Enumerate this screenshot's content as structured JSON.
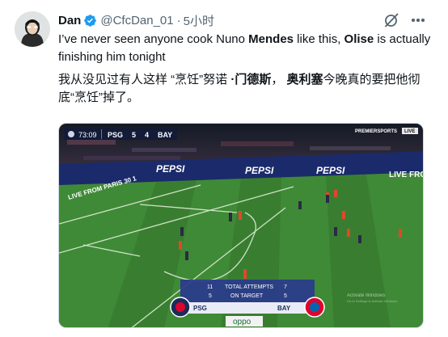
{
  "author": {
    "name": "Dan",
    "handle": "@CfcDan_01",
    "separator": "·",
    "time": "5小时"
  },
  "tweet": {
    "en_part1": "I’ve never seen anyone cook Nuno ",
    "en_bold1": "Mendes",
    "en_part2": " like this, ",
    "en_bold2": "Olise",
    "en_part3": " is actually  finishing him tonight",
    "zh_part1": "我从没见过有人这样 “烹饪”努诺 ",
    "zh_bold1": "·门德斯",
    "zh_part2": "， ",
    "zh_bold2": "奥利塞",
    "zh_part3": "今晚真的要把他彻底“烹饪”掉了。"
  },
  "media": {
    "scorebug": {
      "clock": "73:09",
      "home": "PSG",
      "home_score": "5",
      "away_score": "4",
      "away": "BAY"
    },
    "broadcaster": "PREMIERSPORTS",
    "broadcaster_live": "LIVE",
    "boards": [
      "PEPSI",
      "PEPSI",
      "PEPSI",
      "LIVE FRO"
    ],
    "board_left": "LIVE FROM PARIS 30 1",
    "stats": {
      "row1_home": "11",
      "row1_label": "TOTAL ATTEMPTS",
      "row1_away": "7",
      "row2_home": "5",
      "row2_label": "ON TARGET",
      "row2_away": "5",
      "home": "PSG",
      "away": "BAY"
    },
    "sponsor": "oppo",
    "watermark_1": "Activate Windows",
    "watermark_2": "Go to Settings to activate Windows."
  },
  "colors": {
    "verified": "#1d9bf0",
    "pitch": "#3f8a36",
    "psg": "#1b2b5c",
    "bayern": "#dc052d",
    "stats_bar": "#2a3a8c"
  },
  "icons": {
    "verified": "verified-badge-icon",
    "grok": "grok-icon",
    "more": "more-options-icon"
  }
}
